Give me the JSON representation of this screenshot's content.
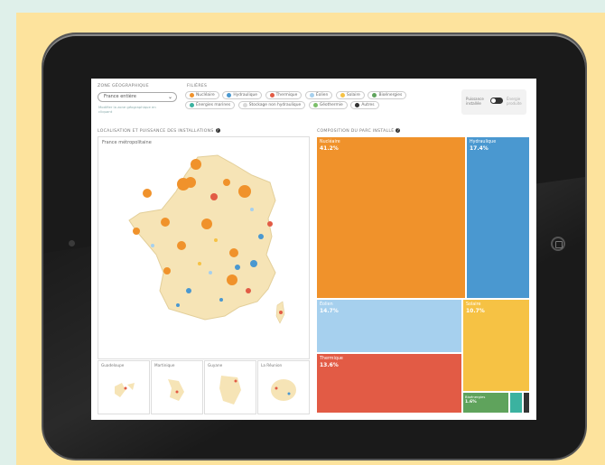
{
  "filters": {
    "zone_label": "ZONE GÉOGRAPHIQUE",
    "zone_value": "France entière",
    "zone_hint": "Modifier la zone géographique en cliquant",
    "sources_label": "FILIÈRES",
    "sources": [
      {
        "label": "Nucléaire",
        "color": "#f0922b"
      },
      {
        "label": "Hydraulique",
        "color": "#4a98d0"
      },
      {
        "label": "Thermique",
        "color": "#e25b45"
      },
      {
        "label": "Éolien",
        "color": "#a6d0ee"
      },
      {
        "label": "Solaire",
        "color": "#f6c244"
      },
      {
        "label": "Bioénergies",
        "color": "#5fa35c"
      },
      {
        "label": "Énergies marines",
        "color": "#3bb2a0"
      },
      {
        "label": "Stockage non hydraulique",
        "color": "#d9d9d9"
      },
      {
        "label": "Géothermie",
        "color": "#7bbf6a"
      },
      {
        "label": "Autres",
        "color": "#333333"
      }
    ],
    "toggle_left": "Puissance installée",
    "toggle_right": "Énergie produite"
  },
  "map": {
    "section_title": "LOCALISATION ET PUISSANCE DES INSTALLATIONS",
    "subtitle": "France métropolitaine",
    "overseas": [
      "Guadeloupe",
      "Martinique",
      "Guyane",
      "La Réunion"
    ]
  },
  "treemap": {
    "section_title": "COMPOSITION DU PARC INSTALLÉ",
    "tiles": [
      {
        "name": "Nucléaire",
        "value": "41.2%",
        "color": "#f0922b"
      },
      {
        "name": "Hydraulique",
        "value": "17.4%",
        "color": "#4a98d0"
      },
      {
        "name": "Éolien",
        "value": "14.7%",
        "color": "#a6d0ee"
      },
      {
        "name": "Solaire",
        "value": "10.7%",
        "color": "#f6c244"
      },
      {
        "name": "Thermique",
        "value": "13.6%",
        "color": "#e25b45"
      },
      {
        "name": "Bioénergies",
        "value": "1.6%",
        "color": "#5fa35c"
      }
    ]
  }
}
